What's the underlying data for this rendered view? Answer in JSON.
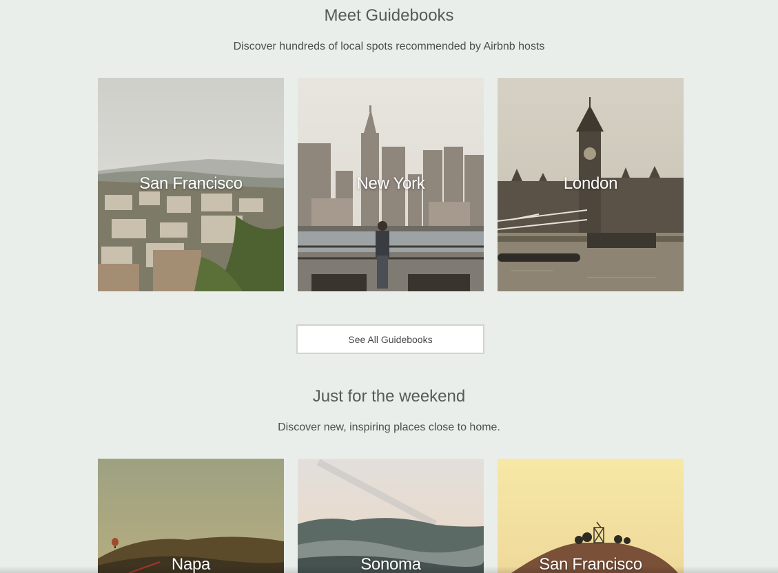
{
  "guidebooks": {
    "title": "Meet Guidebooks",
    "subtitle": "Discover hundreds of local spots recommended by Airbnb hosts",
    "cards": [
      {
        "label": "San Francisco"
      },
      {
        "label": "New York"
      },
      {
        "label": "London"
      }
    ],
    "see_all_label": "See All Guidebooks"
  },
  "weekend": {
    "title": "Just for the weekend",
    "subtitle": "Discover new, inspiring places close to home.",
    "cards": [
      {
        "label": "Napa"
      },
      {
        "label": "Sonoma"
      },
      {
        "label": "San Francisco"
      }
    ]
  }
}
